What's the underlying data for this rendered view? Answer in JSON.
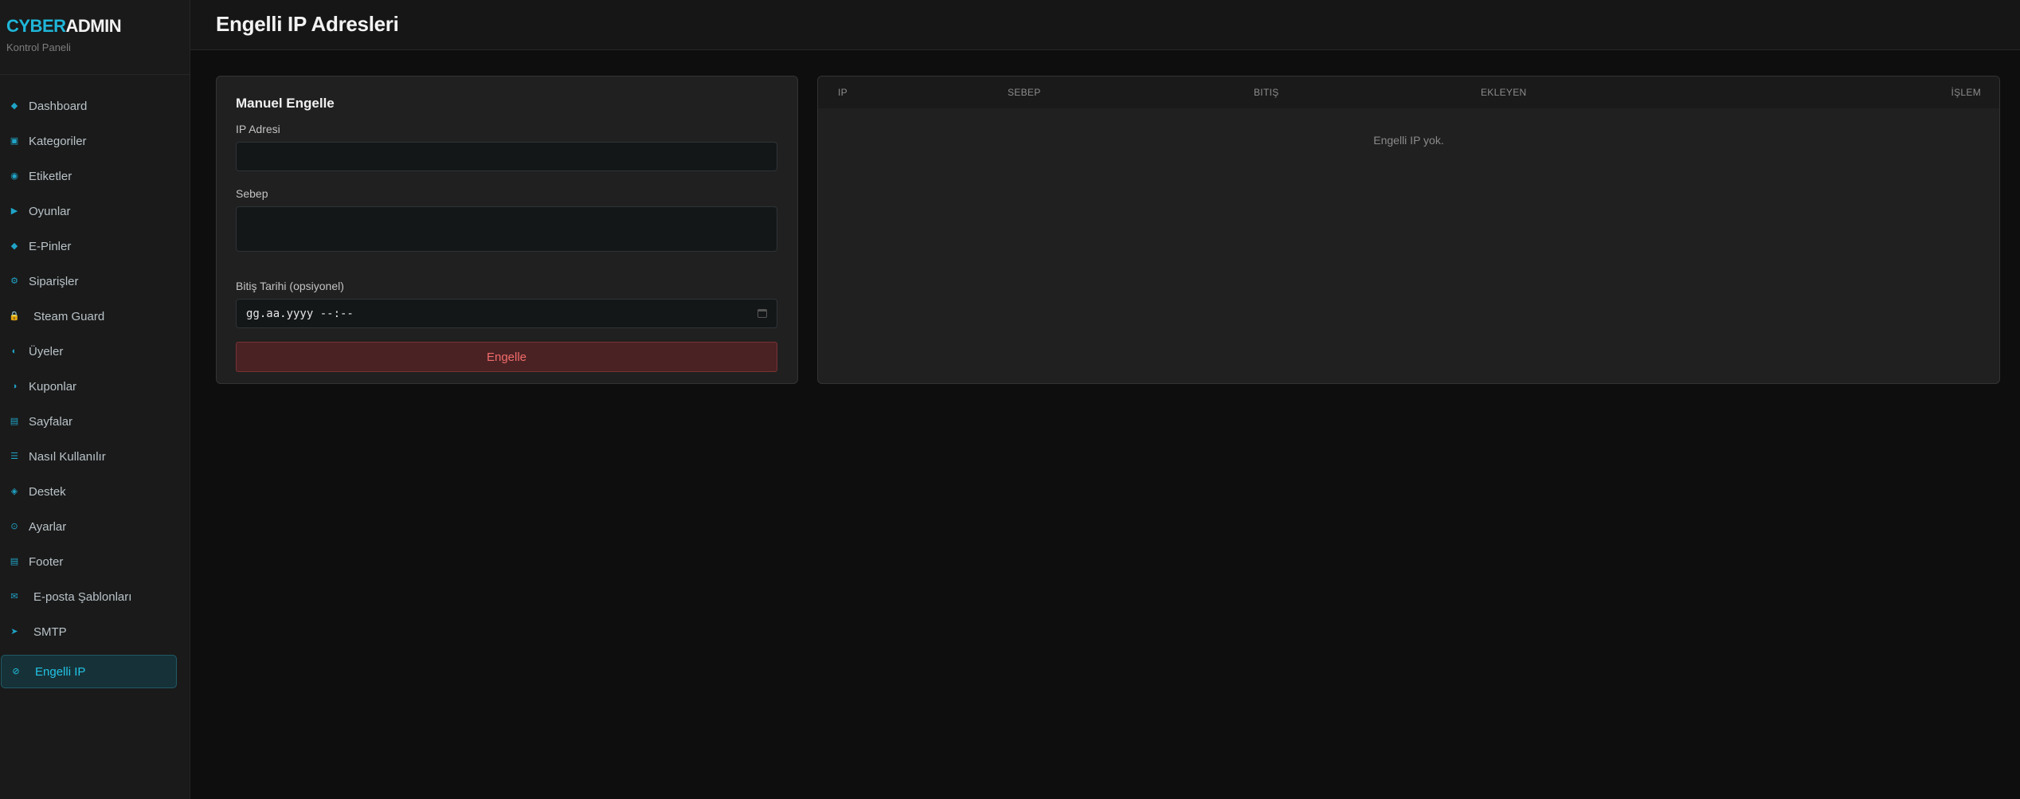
{
  "brand": {
    "part1": "CYBER",
    "part2": "ADMIN",
    "subtitle": "Kontrol Paneli"
  },
  "sidebar": {
    "items": [
      {
        "label": "Dashboard",
        "icon": "◆"
      },
      {
        "label": "Kategoriler",
        "icon": "▣"
      },
      {
        "label": "Etiketler",
        "icon": "◉"
      },
      {
        "label": "Oyunlar",
        "icon": "▶"
      },
      {
        "label": "E-Pinler",
        "icon": "◆"
      },
      {
        "label": "Siparişler",
        "icon": "⚙"
      },
      {
        "label": "Steam Guard",
        "icon": "🔒"
      },
      {
        "label": "Üyeler",
        "icon": "◐"
      },
      {
        "label": "Kuponlar",
        "icon": "◑"
      },
      {
        "label": "Sayfalar",
        "icon": "▤"
      },
      {
        "label": "Nasıl Kullanılır",
        "icon": "☰"
      },
      {
        "label": "Destek",
        "icon": "◈"
      },
      {
        "label": "Ayarlar",
        "icon": "⊙"
      },
      {
        "label": "Footer",
        "icon": "▤"
      },
      {
        "label": "E-posta Şablonları",
        "icon": "✉"
      },
      {
        "label": "SMTP",
        "icon": "➤"
      },
      {
        "label": "Engelli IP",
        "icon": "⊘"
      }
    ]
  },
  "header": {
    "title": "Engelli IP Adresleri"
  },
  "form": {
    "title": "Manuel Engelle",
    "ip_label": "IP Adresi",
    "ip_value": "",
    "reason_label": "Sebep",
    "reason_value": "",
    "end_label": "Bitiş Tarihi (opsiyonel)",
    "end_placeholder": "gg.aa.yyyy --:--",
    "submit_label": "Engelle"
  },
  "table": {
    "columns": [
      "IP",
      "SEBEP",
      "BITIŞ",
      "EKLEYEN",
      "İŞLEM"
    ],
    "empty_text": "Engelli IP yok."
  },
  "colors": {
    "accent": "#1fb6d8",
    "danger": "#f26b6b",
    "danger_bg": "#4a2224"
  }
}
